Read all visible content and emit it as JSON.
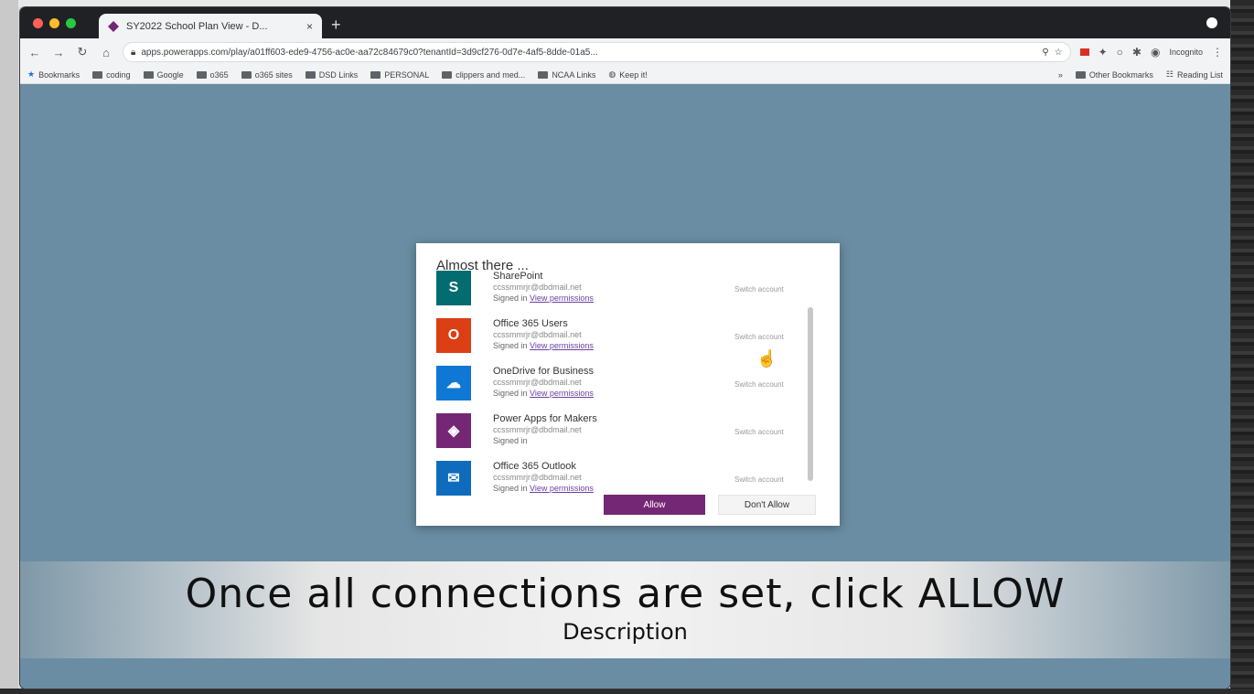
{
  "browser": {
    "tab_title": "SY2022 School Plan View - D...",
    "tab_close": "×",
    "new_tab": "+",
    "url": "apps.powerapps.com/play/a01ff603-ede9-4756-ac0e-aa72c84679c0?tenantId=3d9cf276-0d7e-4af5-8dde-01a5...",
    "incognito_label": "Incognito"
  },
  "bookmarks": {
    "items": [
      "Bookmarks",
      "coding",
      "Google",
      "o365",
      "o365 sites",
      "DSD Links",
      "PERSONAL",
      "clippers and med...",
      "NCAA Links",
      "Keep it!"
    ],
    "overflow": "»",
    "other": "Other Bookmarks",
    "reading_list": "Reading List"
  },
  "dialog": {
    "title": "Almost there ...",
    "connections": [
      {
        "name": "SharePoint",
        "email": "ccssmmrjr@dbdmail.net",
        "status": "Signed in",
        "link": "View permissions",
        "switch": "Switch account",
        "icon": "sharepoint-icon",
        "color": "#036c70",
        "glyph": "S"
      },
      {
        "name": "Office 365 Users",
        "email": "ccssmmrjr@dbdmail.net",
        "status": "Signed in",
        "link": "View permissions",
        "switch": "Switch account",
        "icon": "office365-icon",
        "color": "#dc3e15",
        "glyph": "O"
      },
      {
        "name": "OneDrive for Business",
        "email": "ccssmmrjr@dbdmail.net",
        "status": "Signed in",
        "link": "View permissions",
        "switch": "Switch account",
        "icon": "onedrive-icon",
        "color": "#0f78d4",
        "glyph": "☁"
      },
      {
        "name": "Power Apps for Makers",
        "email": "ccssmmrjr@dbdmail.net",
        "status": "Signed in",
        "link": "",
        "switch": "Switch account",
        "icon": "powerapps-icon",
        "color": "#742774",
        "glyph": "◈"
      },
      {
        "name": "Office 365 Outlook",
        "email": "ccssmmrjr@dbdmail.net",
        "status": "Signed in",
        "link": "View permissions",
        "switch": "Switch account",
        "icon": "outlook-icon",
        "color": "#0f6cbd",
        "glyph": "✉"
      }
    ],
    "allow_label": "Allow",
    "deny_label": "Don't Allow"
  },
  "caption": {
    "main": "Once all connections are set, click ALLOW",
    "sub": "Description"
  }
}
